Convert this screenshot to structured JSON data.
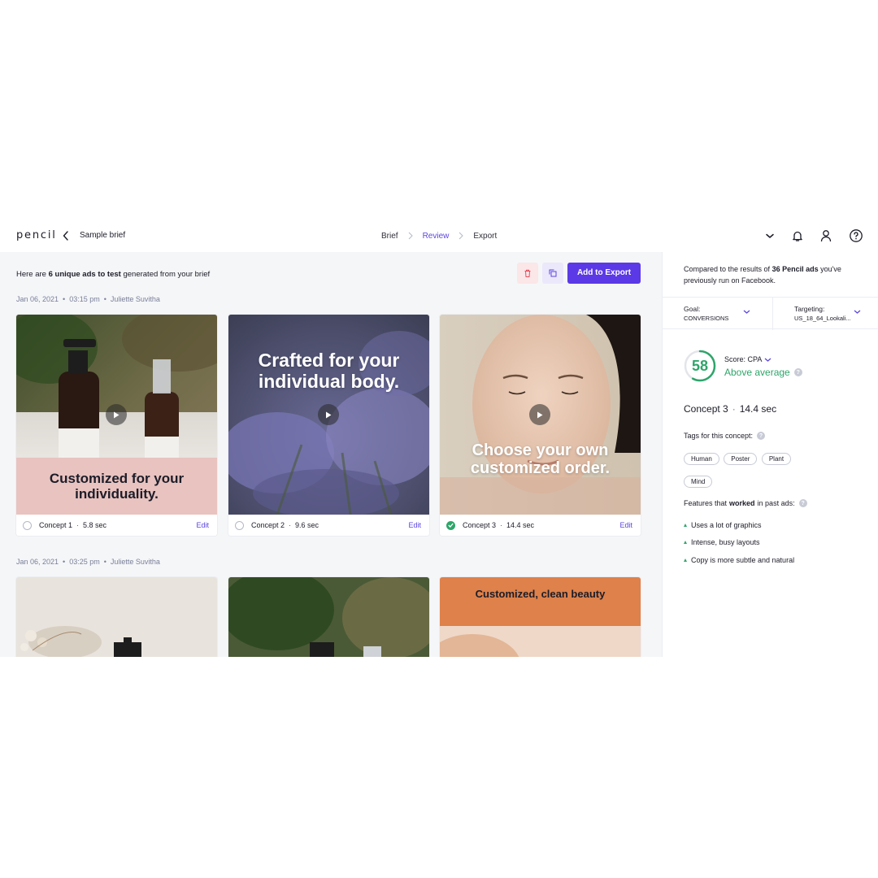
{
  "app": {
    "logo": "pencil",
    "brief_title": "Sample brief",
    "steps": [
      "Brief",
      "Review",
      "Export"
    ],
    "active_step": "Review"
  },
  "main": {
    "intro_prefix": "Here are ",
    "intro_bold": "6 unique ads to test",
    "intro_suffix": " generated from your brief",
    "add_export_label": "Add to Export",
    "groups": [
      {
        "date": "Jan 06, 2021",
        "time": "03:15 pm",
        "author": "Juliette Suvitha"
      },
      {
        "date": "Jan 06, 2021",
        "time": "03:25 pm",
        "author": "Juliette Suvitha"
      }
    ],
    "concepts": [
      {
        "name": "Concept 1",
        "duration": "5.8 sec",
        "edit": "Edit",
        "headline": "Customized for your individuality.",
        "selected": false
      },
      {
        "name": "Concept 2",
        "duration": "9.6 sec",
        "edit": "Edit",
        "headline": "Crafted for your individual body.",
        "selected": false
      },
      {
        "name": "Concept 3",
        "duration": "14.4 sec",
        "edit": "Edit",
        "headline": "Choose your own customized order.",
        "selected": true
      }
    ],
    "row2_headline_3": "Customized, clean beauty"
  },
  "panel": {
    "compare_prefix": "Compared to the results of ",
    "compare_bold": "36 Pencil ads",
    "compare_suffix": " you've previously run on Facebook.",
    "goal_label": "Goal:",
    "goal_value": "CONVERSIONS",
    "targeting_label": "Targeting:",
    "targeting_value": "US_18_64_Lookali...",
    "score": "58",
    "score_fraction": 0.58,
    "score_label": "Score: CPA",
    "score_status": "Above average",
    "concept_name": "Concept 3",
    "concept_duration": "14.4 sec",
    "tags_heading": "Tags for this concept:",
    "tags": [
      "Human",
      "Poster",
      "Plant",
      "Mind"
    ],
    "features_prefix": "Features that",
    "features_bold": "worked",
    "features_suffix": "in past ads:",
    "features": [
      "Uses a lot of graphics",
      "Intense, busy layouts",
      "Copy is more subtle and natural"
    ]
  },
  "colors": {
    "accent": "#5b39e6",
    "link": "#5b46e0",
    "success": "#2ea56a",
    "muted": "#7a7f99",
    "danger": "#e0505e"
  }
}
